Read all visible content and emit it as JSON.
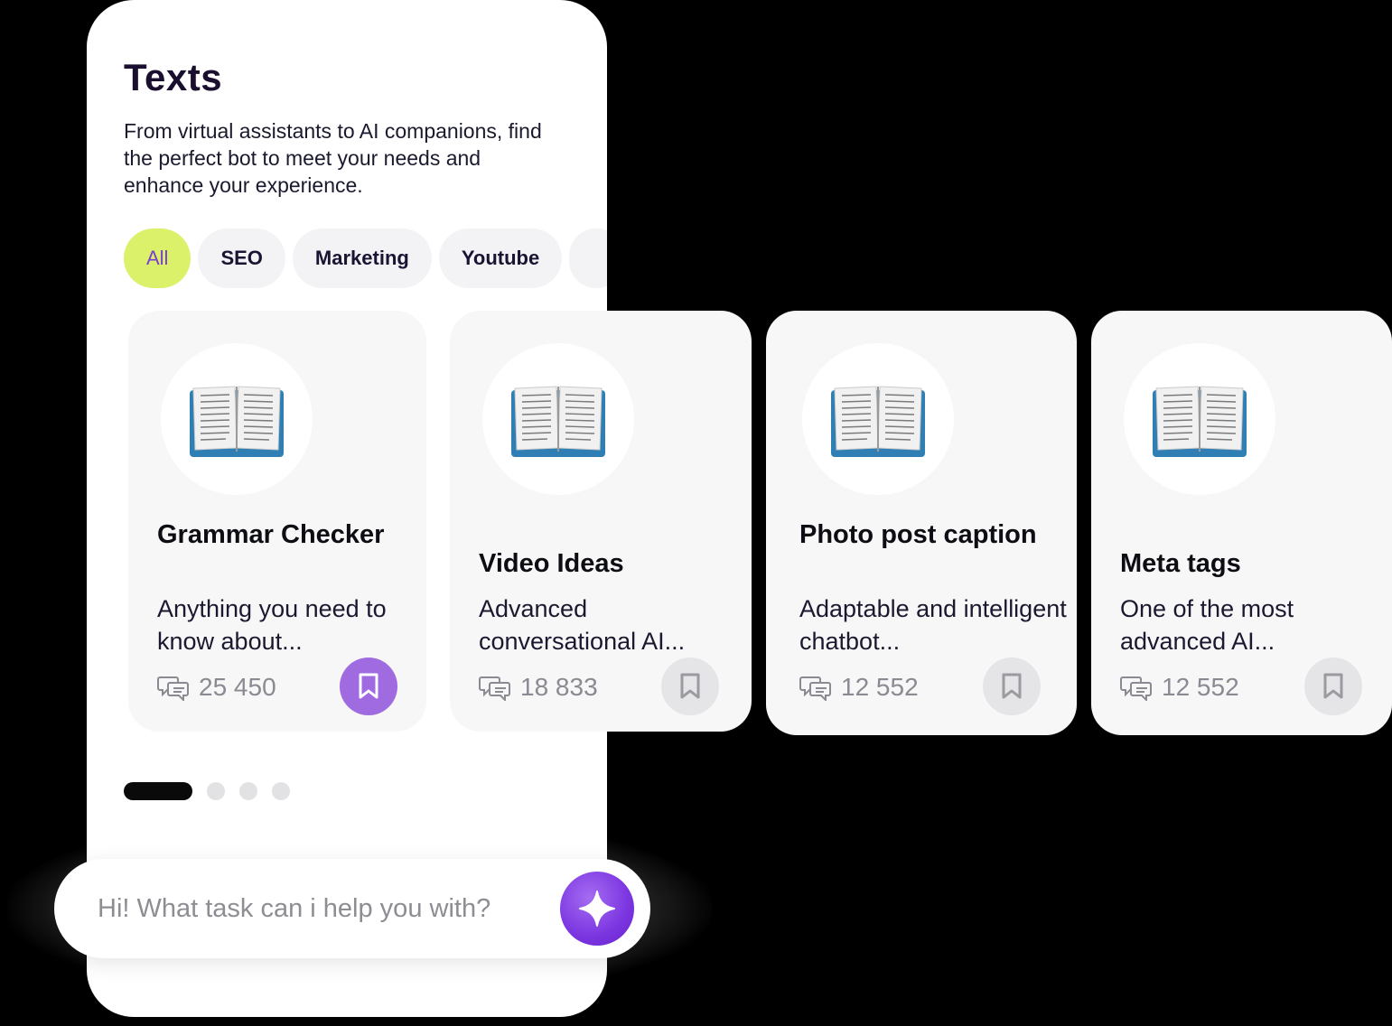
{
  "header": {
    "title": "Texts",
    "subtitle": "From virtual assistants to AI companions, find the perfect bot to meet your needs and enhance your experience."
  },
  "chips": [
    {
      "label": "All",
      "active": true
    },
    {
      "label": "SEO",
      "active": false
    },
    {
      "label": "Marketing",
      "active": false
    },
    {
      "label": "Youtube",
      "active": false
    },
    {
      "label": "",
      "active": false
    }
  ],
  "cards": [
    {
      "icon": "open-book-icon",
      "title": "Grammar Checker",
      "description": "Anything you need to know about...",
      "count": "25 450",
      "bookmarked": true
    },
    {
      "icon": "open-book-icon",
      "title": "Video Ideas",
      "description": "Advanced conversational AI...",
      "count": "18 833",
      "bookmarked": false
    },
    {
      "icon": "open-book-icon",
      "title": "Photo post caption",
      "description": "Adaptable and intelligent chatbot...",
      "count": "12 552",
      "bookmarked": false
    },
    {
      "icon": "open-book-icon",
      "title": "Meta tags",
      "description": "One of the most advanced AI...",
      "count": "12 552",
      "bookmarked": false
    }
  ],
  "pagination": {
    "total": 4,
    "current": 1
  },
  "prompt": {
    "placeholder": "Hi! What task can i help you with?",
    "value": ""
  },
  "colors": {
    "accent": "#7b35e0",
    "chip_active_bg": "#dcf16a",
    "bookmark_active": "#a06be0"
  }
}
